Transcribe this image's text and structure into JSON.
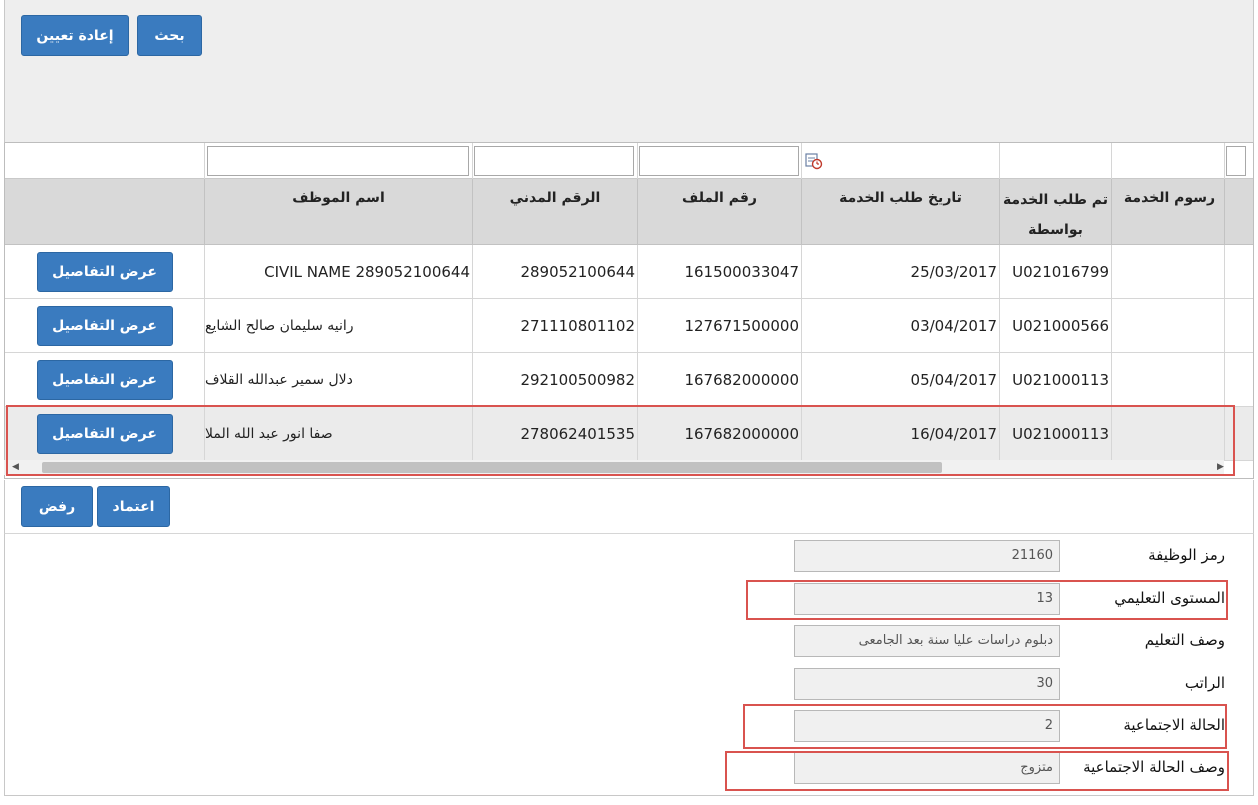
{
  "toolbar": {
    "search_label": "بحث",
    "reset_label": "إعادة تعيين"
  },
  "grid": {
    "columns": {
      "employee_name": "اسم الموظف",
      "civil_id": "الرقم المدني",
      "file_number": "رقم الملف",
      "request_date": "تاريخ طلب الخدمة",
      "requested_by_line1": "تم طلب الخدمة",
      "requested_by_line2": "بواسطة",
      "service_fees": "رسوم الخدمة"
    },
    "rows": [
      {
        "details": "عرض التفاصيل",
        "employee_name": "CIVIL NAME 289052100644",
        "civil_id": "289052100644",
        "file_number": "161500033047",
        "request_date": "25/03/2017",
        "requested_by": "U021016799"
      },
      {
        "details": "عرض التفاصيل",
        "employee_name": "رانيه سليمان صالح الشايع",
        "civil_id": "271110801102",
        "file_number": "127671500000",
        "request_date": "03/04/2017",
        "requested_by": "U021000566"
      },
      {
        "details": "عرض التفاصيل",
        "employee_name": "دلال سمير عبدالله القلاف",
        "civil_id": "292100500982",
        "file_number": "167682000000",
        "request_date": "05/04/2017",
        "requested_by": "U021000113"
      },
      {
        "details": "عرض التفاصيل",
        "employee_name": "صفا انور عبد الله الملا",
        "civil_id": "278062401535",
        "file_number": "167682000000",
        "request_date": "16/04/2017",
        "requested_by": "U021000113",
        "selected": true
      }
    ]
  },
  "actions": {
    "approve_label": "اعتماد",
    "reject_label": "رفض"
  },
  "form": {
    "job_code": {
      "label": "رمز الوظيفة",
      "value": "21160"
    },
    "education_level": {
      "label": "المستوى التعليمي",
      "value": "13"
    },
    "education_desc": {
      "label": "وصف التعليم",
      "value": "دبلوم دراسات عليا سنة بعد الجامعى"
    },
    "salary": {
      "label": "الراتب",
      "value": "30"
    },
    "marital_status": {
      "label": "الحالة الاجتماعية",
      "value": "2"
    },
    "marital_status_desc": {
      "label": "وصف الحالة الاجتماعية",
      "value": "متزوج"
    }
  },
  "colors": {
    "button": "#3a7bbf",
    "highlight": "#d9534f",
    "header_bg": "#d9d9d9"
  }
}
